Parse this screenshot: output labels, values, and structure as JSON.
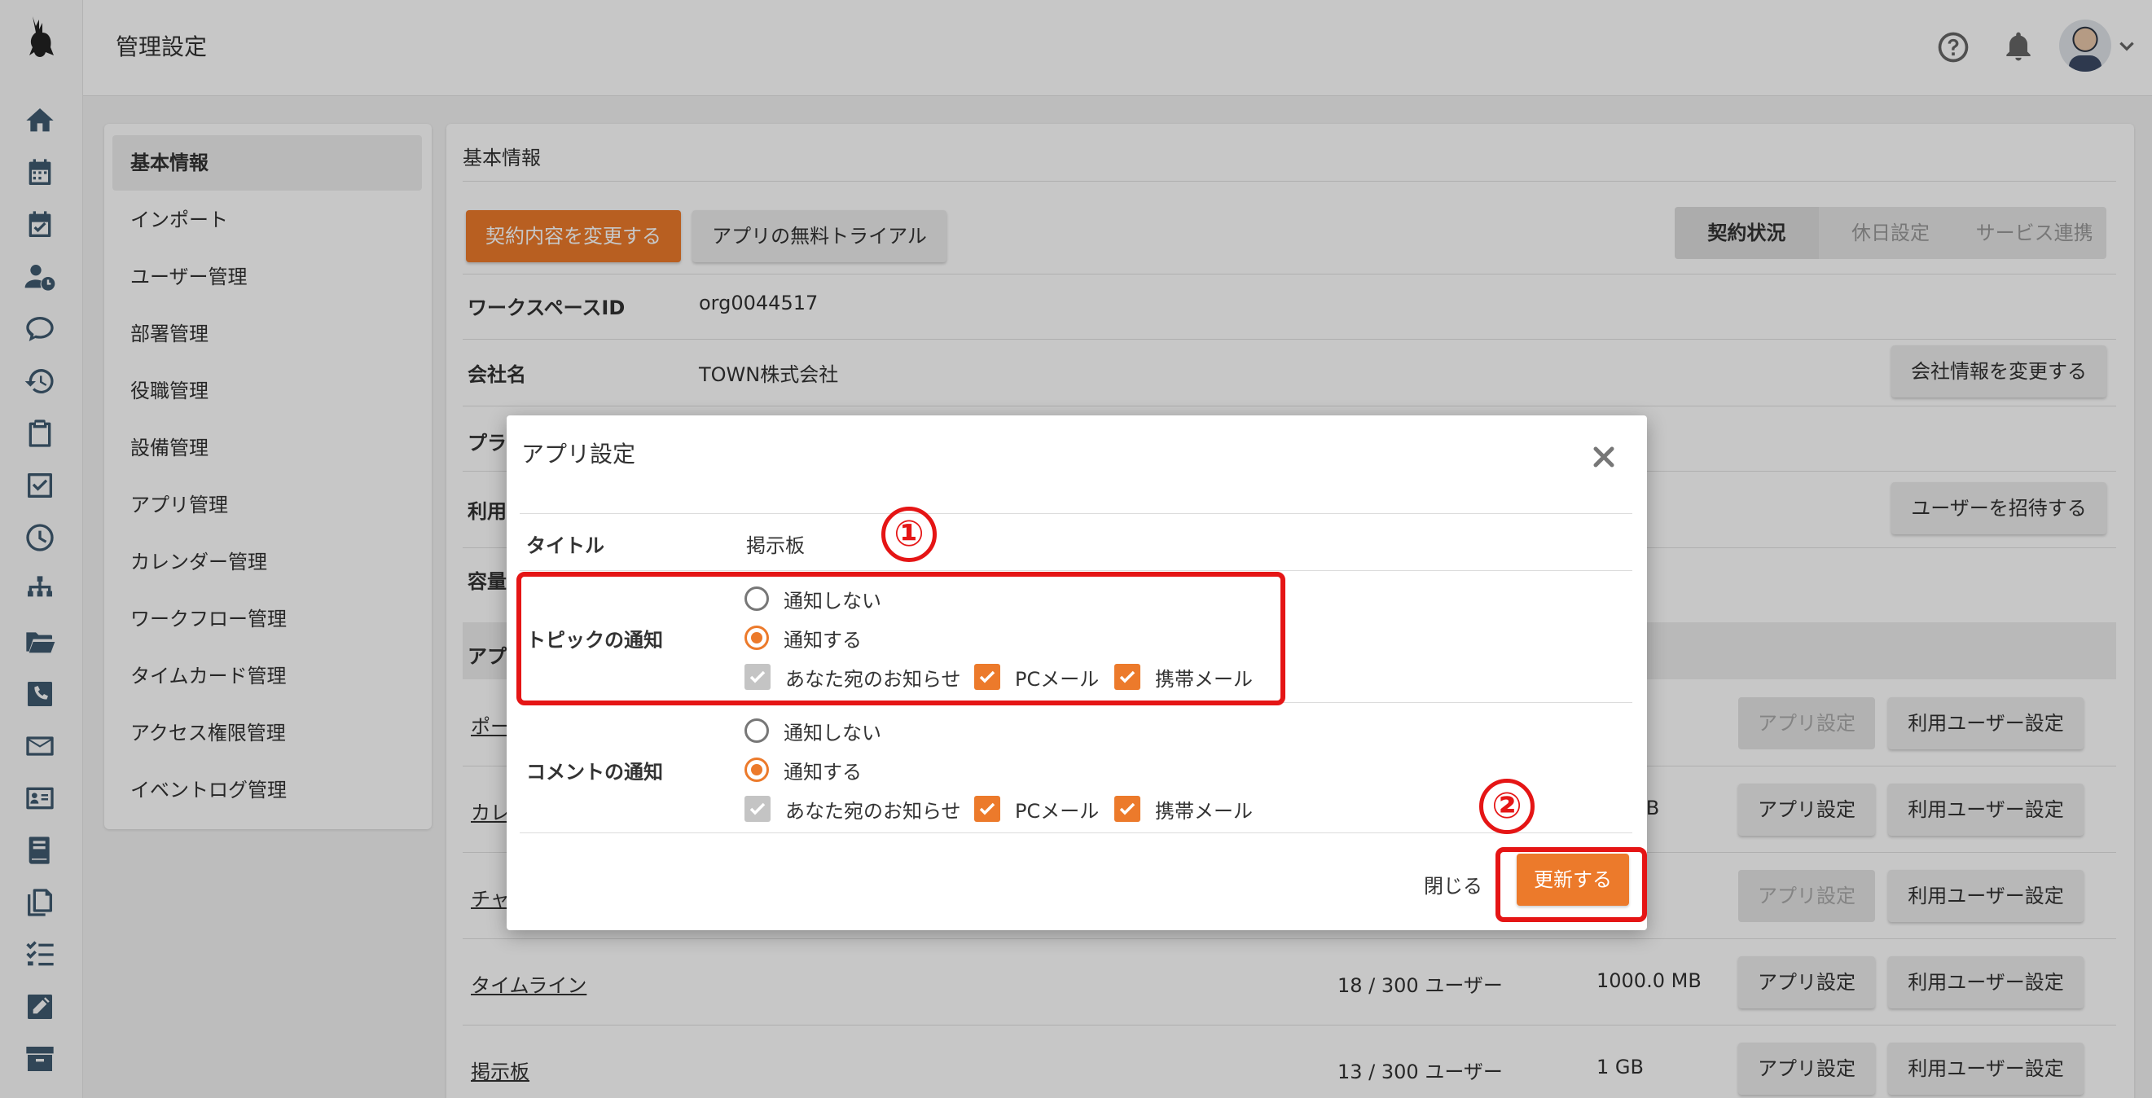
{
  "header": {
    "title": "管理設定"
  },
  "menu": {
    "items": [
      {
        "label": "基本情報",
        "active": true
      },
      {
        "label": "インポート"
      },
      {
        "label": "ユーザー管理"
      },
      {
        "label": "部署管理"
      },
      {
        "label": "役職管理"
      },
      {
        "label": "設備管理"
      },
      {
        "label": "アプリ管理"
      },
      {
        "label": "カレンダー管理"
      },
      {
        "label": "ワークフロー管理"
      },
      {
        "label": "タイムカード管理"
      },
      {
        "label": "アクセス権限管理"
      },
      {
        "label": "イベントログ管理"
      }
    ]
  },
  "main": {
    "title": "基本情報",
    "change_contract_button": "契約内容を変更する",
    "free_trial_button": "アプリの無料トライアル",
    "tabs": [
      "契約状況",
      "休日設定",
      "サービス連携"
    ],
    "workspace_label": "ワークスペースID",
    "workspace_value": "org0044517",
    "company_label": "会社名",
    "company_value": "TOWN株式会社",
    "change_company_button": "会社情報を変更する",
    "plan_label_partial": "プラ",
    "usage_label_partial": "利用",
    "invite_user_button": "ユーザーを招待する",
    "capacity_label_partial": "容量",
    "apps_header_partial": "アプ",
    "apps": [
      {
        "name_partial": "ポー",
        "users": "",
        "size": "",
        "app_settings": "アプリ設定",
        "user_settings": "利用ユーザー設定"
      },
      {
        "name_partial": "カレ",
        "users": "",
        "size_partial": "MB",
        "app_settings": "アプリ設定",
        "user_settings": "利用ユーザー設定"
      },
      {
        "name_partial": "チャ",
        "users": "",
        "size": "",
        "app_settings": "アプリ設定",
        "user_settings": "利用ユーザー設定"
      },
      {
        "name": "タイムライン",
        "users": "18 / 300 ユーザー",
        "size": "1000.0 MB",
        "app_settings": "アプリ設定",
        "user_settings": "利用ユーザー設定"
      },
      {
        "name": "掲示板",
        "users": "13 / 300 ユーザー",
        "size": "1 GB",
        "app_settings": "アプリ設定",
        "user_settings": "利用ユーザー設定"
      }
    ]
  },
  "modal": {
    "title": "アプリ設定",
    "title_label": "タイトル",
    "title_value": "掲示板",
    "topic_label": "トピックの通知",
    "comment_label": "コメントの通知",
    "no_notify": "通知しない",
    "notify": "通知する",
    "opt_you": "あなた宛のお知らせ",
    "opt_pc": "PCメール",
    "opt_mobile": "携帯メール",
    "close_link": "閉じる",
    "update_button": "更新する"
  },
  "annotations": {
    "step1": "①",
    "step2": "②"
  },
  "colors": {
    "accent": "#ec7a2b",
    "highlight": "#e51515",
    "icon": "#3f5a70"
  }
}
